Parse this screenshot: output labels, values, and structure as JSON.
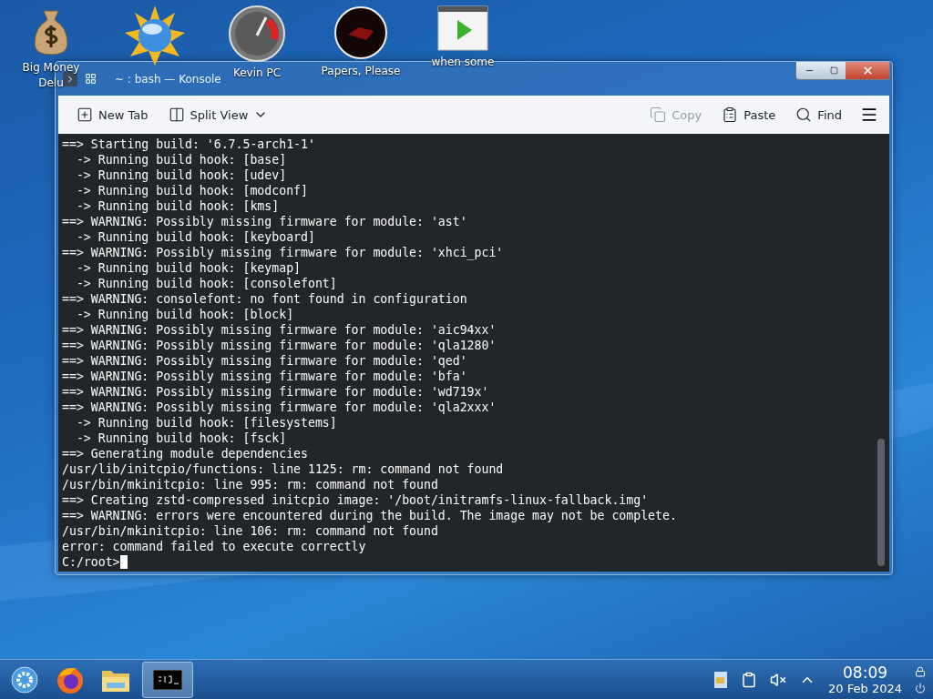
{
  "desktop_icons": [
    {
      "kind": "money",
      "label": "Big Money Delu"
    },
    {
      "kind": "globe"
    },
    {
      "kind": "gauge",
      "label": "Kevin PC"
    },
    {
      "kind": "dark",
      "label": "Papers, Please"
    },
    {
      "kind": "player",
      "label": "when some"
    }
  ],
  "window": {
    "title": "~ : bash — Konsole"
  },
  "toolbar": [
    {
      "kind": "new-tab",
      "label": "New Tab",
      "disabled": false
    },
    {
      "kind": "split",
      "label": "Split View",
      "disabled": false
    },
    {
      "kind": "copy",
      "label": "Copy",
      "disabled": true
    },
    {
      "kind": "paste",
      "label": "Paste",
      "disabled": false
    },
    {
      "kind": "find",
      "label": "Find",
      "disabled": false
    }
  ],
  "terminal": {
    "lines": [
      "==> Starting build: '6.7.5-arch1-1'",
      "  -> Running build hook: [base]",
      "  -> Running build hook: [udev]",
      "  -> Running build hook: [modconf]",
      "  -> Running build hook: [kms]",
      "==> WARNING: Possibly missing firmware for module: 'ast'",
      "  -> Running build hook: [keyboard]",
      "==> WARNING: Possibly missing firmware for module: 'xhci_pci'",
      "  -> Running build hook: [keymap]",
      "  -> Running build hook: [consolefont]",
      "==> WARNING: consolefont: no font found in configuration",
      "  -> Running build hook: [block]",
      "==> WARNING: Possibly missing firmware for module: 'aic94xx'",
      "==> WARNING: Possibly missing firmware for module: 'qla1280'",
      "==> WARNING: Possibly missing firmware for module: 'qed'",
      "==> WARNING: Possibly missing firmware for module: 'bfa'",
      "==> WARNING: Possibly missing firmware for module: 'wd719x'",
      "==> WARNING: Possibly missing firmware for module: 'qla2xxx'",
      "  -> Running build hook: [filesystems]",
      "  -> Running build hook: [fsck]",
      "==> Generating module dependencies",
      "/usr/lib/initcpio/functions: line 1125: rm: command not found",
      "/usr/bin/mkinitcpio: line 995: rm: command not found",
      "==> Creating zstd-compressed initcpio image: '/boot/initramfs-linux-fallback.img'",
      "==> WARNING: errors were encountered during the build. The image may not be complete.",
      "/usr/bin/mkinitcpio: line 106: rm: command not found",
      "error: command failed to execute correctly"
    ],
    "prompt": "C:/root>"
  },
  "taskbar": {
    "apps": [
      {
        "kind": "launcher",
        "selected": false
      },
      {
        "kind": "browser",
        "selected": false
      },
      {
        "kind": "folder",
        "selected": false
      },
      {
        "kind": "terminal",
        "selected": true
      }
    ],
    "clock": {
      "time": "08:09",
      "date": "20 Feb 2024"
    }
  }
}
